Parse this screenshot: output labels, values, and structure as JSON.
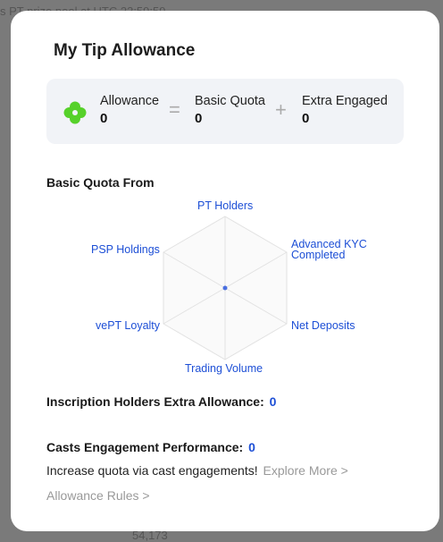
{
  "backdrop": {
    "top_text": "s PT prize pool at UTC 23:59:59",
    "bottom_number": "54,173"
  },
  "modal": {
    "title": "My Tip Allowance",
    "summary": {
      "allowance_label": "Allowance",
      "allowance_value": "0",
      "equals_symbol": "=",
      "basic_quota_label": "Basic Quota",
      "basic_quota_value": "0",
      "plus_symbol": "+",
      "extra_engaged_label": "Extra Engaged",
      "extra_engaged_value": "0",
      "icon": "clover-icon",
      "icon_color": "#56d12a"
    },
    "basic_quota": {
      "heading": "Basic Quota From",
      "axes": {
        "pt_holders": "PT Holders",
        "advanced_kyc_1": "Advanced KYC",
        "advanced_kyc_2": "Completed",
        "net_deposits": "Net Deposits",
        "trading_volume": "Trading Volume",
        "vept_loyalty": "vePT Loyalty",
        "psp_holdings": "PSP Holdings"
      },
      "axis_color": "#1d4fd6",
      "values": [
        0,
        0,
        0,
        0,
        0,
        0
      ]
    },
    "inscription": {
      "label": "Inscription Holders Extra Allowance:",
      "value": "0"
    },
    "casts": {
      "label": "Casts Engagement Performance:",
      "value": "0",
      "info_text": "Increase quota via cast engagements!",
      "explore_link": "Explore More >",
      "rules_link": "Allowance Rules >"
    }
  }
}
